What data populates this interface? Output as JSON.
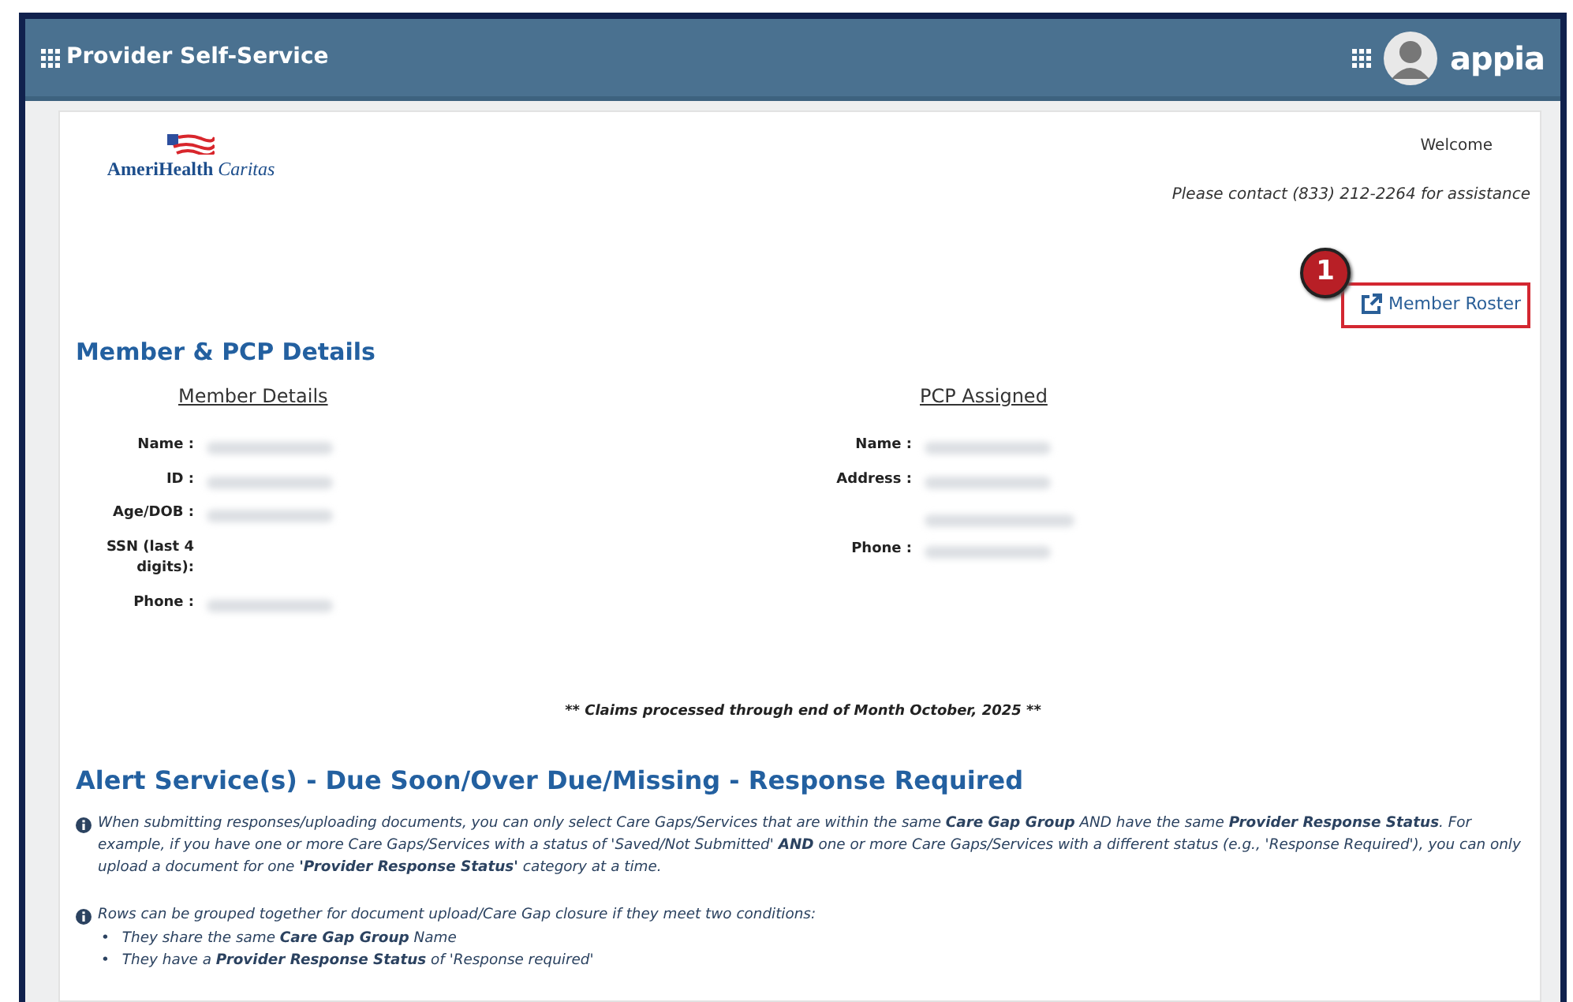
{
  "app_bar": {
    "title": "Provider Self-Service",
    "brand": "appia"
  },
  "logo": {
    "text": "**AmeriHealth** *Caritas*"
  },
  "welcome": "Welcome",
  "contact": "Please contact (833) 212-2264 for assistance",
  "callout": {
    "number": "1"
  },
  "member_roster": {
    "label": "Member Roster"
  },
  "section_title": "Member & PCP Details",
  "member_details": {
    "heading": "Member Details",
    "fields": [
      {
        "label": "Name :",
        "kind": "value"
      },
      {
        "label": "ID :",
        "kind": "value"
      },
      {
        "label": "Age/DOB :",
        "kind": "value"
      },
      {
        "label": "SSN (last 4 digits):",
        "kind": "empty"
      },
      {
        "label": "Phone :",
        "kind": "value"
      }
    ]
  },
  "pcp_assigned": {
    "heading": "PCP Assigned",
    "fields": [
      {
        "label": "Name :",
        "kind": "value"
      },
      {
        "label": "Address :",
        "kind": "two-line"
      },
      {
        "label": "Phone :",
        "kind": "value"
      }
    ]
  },
  "claims_note": "** Claims processed through end of Month October, 2025 **",
  "alert_title": "Alert Service(s) - Due Soon/Over Due/Missing - Response Required",
  "notes": [
    {
      "text": "When submitting responses/uploading documents, you can only select Care Gaps/Services that are within the same **Care Gap Group** AND have the same **Provider Response Status**. For example, if you have one or more Care Gaps/Services with a status of 'Saved/Not Submitted' **AND** one or more Care Gaps/Services with a different status (e.g., 'Response Required'), you can only upload a document for one **'Provider Response Status'** category at a time."
    },
    {
      "text": "Rows can be grouped together for document upload/Care Gap closure if they meet two conditions:",
      "bullets": [
        {
          "marker": "•",
          "text": "They share the same **Care Gap Group** Name"
        },
        {
          "marker": "•",
          "text": "They have a **Provider Response Status** of 'Response required'"
        }
      ]
    }
  ]
}
